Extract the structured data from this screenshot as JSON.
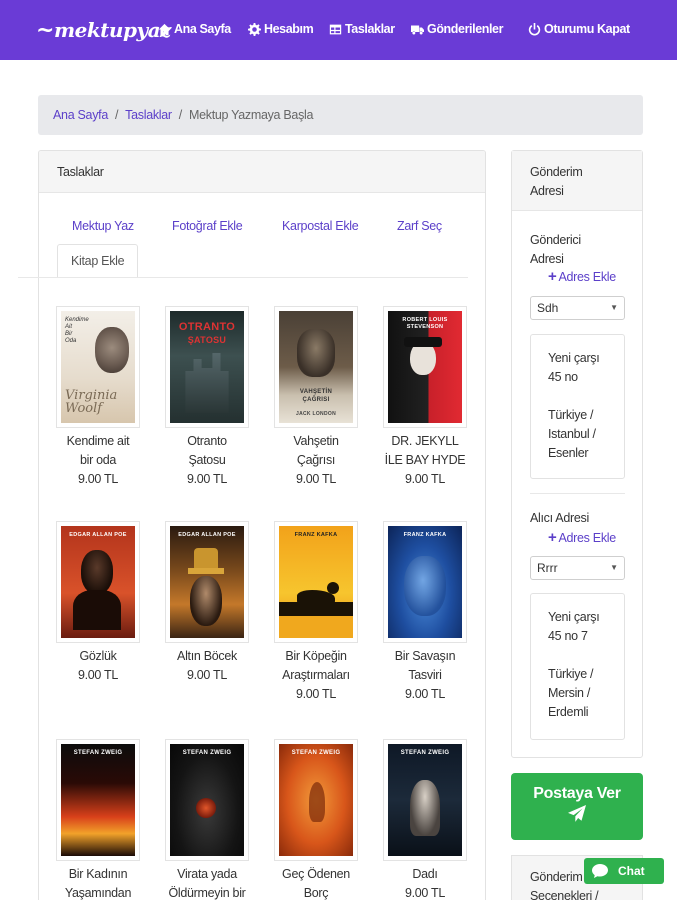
{
  "brand": {
    "logo_text": "mektupyaz"
  },
  "nav": [
    {
      "label": "Ana Sayfa",
      "icon": "home-icon"
    },
    {
      "label": "Hesabım",
      "icon": "gear-icon"
    },
    {
      "label": "Taslaklar",
      "icon": "table-icon"
    },
    {
      "label": "Gönderilenler",
      "icon": "truck-icon"
    },
    {
      "label": "Oturumu Kapat",
      "icon": "power-icon"
    }
  ],
  "breadcrumb": {
    "home": "Ana Sayfa",
    "drafts": "Taslaklar",
    "current": "Mektup Yazmaya Başla"
  },
  "main": {
    "title": "Taslaklar",
    "tabs": [
      "Mektup Yaz",
      "Fotoğraf Ekle",
      "Karpostal Ekle",
      "Zarf Seç",
      "Kitap Ekle"
    ],
    "active_tab": "Kitap Ekle",
    "books": [
      {
        "title_lines": [
          "Kendime ait",
          "bir oda"
        ],
        "price": "9.00 TL",
        "cover_texts": [
          "Kendime",
          "Ait",
          "Bir",
          "Oda",
          "Virginia",
          "Woolf"
        ]
      },
      {
        "title_lines": [
          "Otranto",
          "Şatosu"
        ],
        "price": "9.00 TL",
        "cover_texts": [
          "OTRANTO",
          "ŞATOSU"
        ]
      },
      {
        "title_lines": [
          "Vahşetin",
          "Çağrısı"
        ],
        "price": "9.00 TL",
        "cover_texts": [
          "VAHŞETİN",
          "ÇAĞRISI",
          "JACK LONDON"
        ]
      },
      {
        "title_lines": [
          "DR. JEKYLL",
          "İLE BAY HYDE"
        ],
        "price": "9.00 TL",
        "cover_texts": [
          "ROBERT LOUIS",
          "STEVENSON"
        ]
      },
      {
        "title_lines": [
          "Gözlük"
        ],
        "price": "9.00 TL",
        "cover_texts": [
          "EDGAR ALLAN POE"
        ]
      },
      {
        "title_lines": [
          "Altın Böcek"
        ],
        "price": "9.00 TL",
        "cover_texts": [
          "EDGAR ALLAN POE"
        ]
      },
      {
        "title_lines": [
          "Bir Köpeğin",
          "Araştırmaları"
        ],
        "price": "9.00 TL",
        "cover_texts": [
          "FRANZ KAFKA"
        ]
      },
      {
        "title_lines": [
          "Bir Savaşın",
          "Tasviri"
        ],
        "price": "9.00 TL",
        "cover_texts": [
          "FRANZ KAFKA"
        ]
      },
      {
        "title_lines": [
          "Bir Kadının",
          "Yaşamından"
        ],
        "price": "",
        "cover_texts": [
          "STEFAN ZWEIG"
        ]
      },
      {
        "title_lines": [
          "Virata yada",
          "Öldürmeyin bir"
        ],
        "price": "",
        "cover_texts": [
          "STEFAN ZWEIG"
        ]
      },
      {
        "title_lines": [
          "Geç Ödenen",
          "Borç"
        ],
        "price": "",
        "cover_texts": [
          "STEFAN ZWEIG"
        ]
      },
      {
        "title_lines": [
          "Dadı"
        ],
        "price": "9.00 TL",
        "cover_texts": [
          "STEFAN ZWEIG"
        ]
      }
    ]
  },
  "side": {
    "title": "Gönderim Adresi",
    "sender_label": "Gönderici Adresi",
    "sender_add": "Adres Ekle",
    "sender_selected": "Sdh",
    "sender_address": [
      "Yeni çarşı",
      "45 no",
      "",
      "Türkiye /",
      "Istanbul /",
      "Esenler"
    ],
    "receiver_label": "Alıcı Adresi",
    "receiver_add": "Adres Ekle",
    "receiver_selected": "Rrrr",
    "receiver_address": [
      "Yeni çarşı",
      "45 no 7",
      "",
      "Türkiye /",
      "Mersin /",
      "Erdemli"
    ]
  },
  "post_button": "Postaya Ver",
  "side2_title": "Gönderim Seçenekleri /",
  "chat_label": "Chat",
  "colors": {
    "nav_bg": "#6a3bd6",
    "link": "#5b3fc9",
    "success": "#2fb14e"
  }
}
